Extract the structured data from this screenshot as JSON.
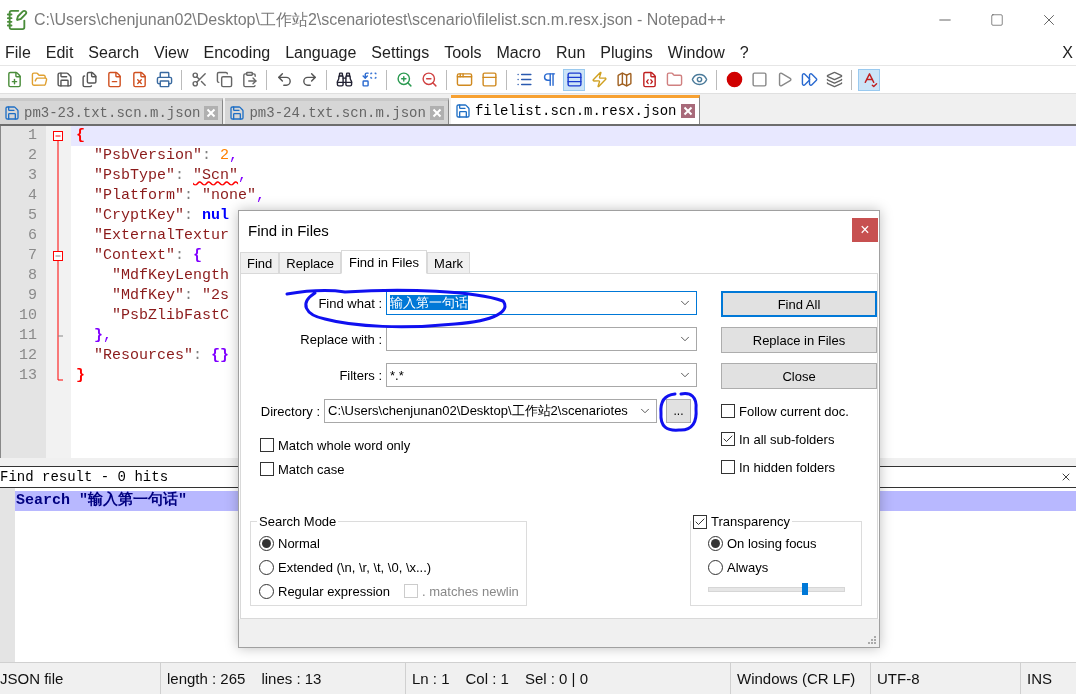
{
  "window": {
    "title": "C:\\Users\\chenjunan02\\Desktop\\工作站2\\scenariotest\\scenario\\filelist.scn.m.resx.json - Notepad++"
  },
  "menu": {
    "items": [
      "File",
      "Edit",
      "Search",
      "View",
      "Encoding",
      "Language",
      "Settings",
      "Tools",
      "Macro",
      "Run",
      "Plugins",
      "Window",
      "?"
    ],
    "close": "X"
  },
  "toolbar": {
    "groups": [
      [
        {
          "pressed": false
        },
        {
          "pressed": false
        },
        {
          "pressed": false
        },
        {
          "pressed": false
        },
        {
          "pressed": false
        },
        {
          "pressed": false
        },
        {
          "pressed": false
        }
      ],
      [
        {
          "pressed": false
        },
        {
          "pressed": false
        },
        {
          "pressed": false
        }
      ],
      [
        {
          "pressed": false
        },
        {
          "pressed": false
        }
      ],
      [
        {
          "pressed": false
        },
        {
          "pressed": false
        }
      ],
      [
        {
          "pressed": false
        },
        {
          "pressed": false
        }
      ],
      [
        {
          "pressed": false
        },
        {
          "pressed": false
        }
      ],
      [
        {
          "pressed": false
        },
        {
          "pressed": false
        },
        {
          "pressed": true
        },
        {
          "pressed": false
        },
        {
          "pressed": false
        },
        {
          "pressed": false
        },
        {
          "pressed": false
        },
        {
          "pressed": false
        }
      ],
      [
        {
          "pressed": false
        },
        {
          "pressed": false
        },
        {
          "pressed": false
        },
        {
          "pressed": false
        },
        {
          "pressed": false
        }
      ],
      [
        {
          "pressed": true
        }
      ]
    ]
  },
  "tabs": [
    {
      "label": "pm3-23.txt.scn.m.json",
      "selected": false
    },
    {
      "label": "pm3-24.txt.scn.m.json",
      "selected": false
    },
    {
      "label": "filelist.scn.m.resx.json",
      "selected": true
    }
  ],
  "editor": {
    "lines": [
      {
        "number": "1",
        "current": true,
        "kind": "start",
        "tokens": [
          {
            "kind": "outer-brace",
            "text": "{"
          }
        ]
      },
      {
        "number": "2",
        "current": false,
        "kind": "body",
        "tokens": [
          {
            "kind": "key",
            "text": "  \"PsbVersion\""
          },
          {
            "kind": "colon",
            "text": ": "
          },
          {
            "kind": "number",
            "text": "2"
          },
          {
            "kind": "comma",
            "text": ","
          }
        ]
      },
      {
        "number": "3",
        "current": false,
        "kind": "body",
        "tokens": [
          {
            "kind": "key",
            "text": "  \"PsbType\""
          },
          {
            "kind": "colon",
            "text": ": "
          },
          {
            "kind": "misspelled-string",
            "text": "\"Scn\""
          },
          {
            "kind": "comma",
            "text": ","
          }
        ]
      },
      {
        "number": "4",
        "current": false,
        "kind": "body",
        "tokens": [
          {
            "kind": "key",
            "text": "  \"Platform\""
          },
          {
            "kind": "colon",
            "text": ": "
          },
          {
            "kind": "string",
            "text": "\"none\""
          },
          {
            "kind": "comma",
            "text": ","
          }
        ]
      },
      {
        "number": "5",
        "current": false,
        "kind": "body",
        "tokens": [
          {
            "kind": "key",
            "text": "  \"CryptKey\""
          },
          {
            "kind": "colon",
            "text": ": "
          },
          {
            "kind": "keyword",
            "text": "nul"
          }
        ]
      },
      {
        "number": "6",
        "current": false,
        "kind": "body",
        "tokens": [
          {
            "kind": "key",
            "text": "  \"ExternalTextur"
          }
        ]
      },
      {
        "number": "7",
        "current": false,
        "kind": "sub-start",
        "tokens": [
          {
            "kind": "key",
            "text": "  \"Context\""
          },
          {
            "kind": "colon",
            "text": ": "
          },
          {
            "kind": "brace",
            "text": "{"
          }
        ]
      },
      {
        "number": "8",
        "current": false,
        "kind": "body",
        "tokens": [
          {
            "kind": "key",
            "text": "    \"MdfKeyLength"
          }
        ]
      },
      {
        "number": "9",
        "current": false,
        "kind": "body",
        "tokens": [
          {
            "kind": "key",
            "text": "    \"MdfKey\""
          },
          {
            "kind": "colon",
            "text": ": "
          },
          {
            "kind": "string",
            "text": "\"2s"
          }
        ]
      },
      {
        "number": "10",
        "current": false,
        "kind": "body",
        "tokens": [
          {
            "kind": "key",
            "text": "    \"PsbZlibFastC"
          }
        ]
      },
      {
        "number": "11",
        "current": false,
        "kind": "sub-end",
        "tokens": [
          {
            "kind": "brace",
            "text": "  }"
          },
          {
            "kind": "comma",
            "text": ","
          }
        ]
      },
      {
        "number": "12",
        "current": false,
        "kind": "body",
        "tokens": [
          {
            "kind": "key",
            "text": "  \"Resources\""
          },
          {
            "kind": "colon",
            "text": ": "
          },
          {
            "kind": "brace",
            "text": "{}"
          }
        ]
      },
      {
        "number": "13",
        "current": false,
        "kind": "end",
        "tokens": [
          {
            "kind": "outer-brace",
            "text": "}"
          }
        ]
      }
    ]
  },
  "find_result": {
    "title": "Find result - 0 hits",
    "lines": [
      "Search \"输入第一句话\""
    ]
  },
  "status_bar": {
    "sections": [
      [
        "JSON file"
      ],
      [
        "length : 265",
        "lines : 13"
      ],
      [
        "Ln : 1",
        "Col : 1",
        "Sel : 0 | 0"
      ],
      [
        "Windows (CR LF)"
      ],
      [
        "UTF-8"
      ],
      [
        "INS"
      ]
    ]
  },
  "dialog": {
    "title": "Find in Files",
    "close": "×",
    "tabs": [
      {
        "label": "Find",
        "selected": false
      },
      {
        "label": "Replace",
        "selected": false
      },
      {
        "label": "Find in Files",
        "selected": true
      },
      {
        "label": "Mark",
        "selected": false
      }
    ],
    "fields": [
      {
        "label": "Find what :",
        "value": "输入第一句话",
        "value_selected": true
      },
      {
        "label": "Replace with :",
        "value_selected": false
      },
      {
        "label": "Filters :",
        "value": "*.*",
        "value_selected": false
      }
    ],
    "directory": {
      "label": "Directory :",
      "value": "C:\\Users\\chenjunan02\\Desktop\\工作站2\\scenariotes",
      "browse": "..."
    },
    "buttons": [
      {
        "label": "Find All",
        "default": true
      },
      {
        "label": "Replace in Files",
        "default": false
      },
      {
        "label": "Close",
        "default": false
      }
    ],
    "options_left": [
      {
        "label": "Match whole word only",
        "checked": false
      },
      {
        "label": "Match case",
        "checked": false
      }
    ],
    "options_right": [
      {
        "label": "Follow current doc.",
        "checked": false
      },
      {
        "label": "In all sub-folders",
        "checked": true
      },
      {
        "label": "In hidden folders",
        "checked": false
      }
    ],
    "search_mode": {
      "title": "Search Mode",
      "modes": [
        {
          "label": "Normal",
          "selected": true
        },
        {
          "label": "Extended (\\n, \\r, \\t, \\0, \\x...)",
          "selected": false
        },
        {
          "label": "Regular expression",
          "selected": false
        }
      ],
      "dot_newline": {
        "label": ". matches newlin",
        "checked": false,
        "disabled": true
      }
    },
    "transparency": {
      "label": "Transparency",
      "checked": true,
      "modes": [
        {
          "label": "On losing focus",
          "selected": true
        },
        {
          "label": "Always",
          "selected": false
        }
      ],
      "level": 0.71
    }
  }
}
